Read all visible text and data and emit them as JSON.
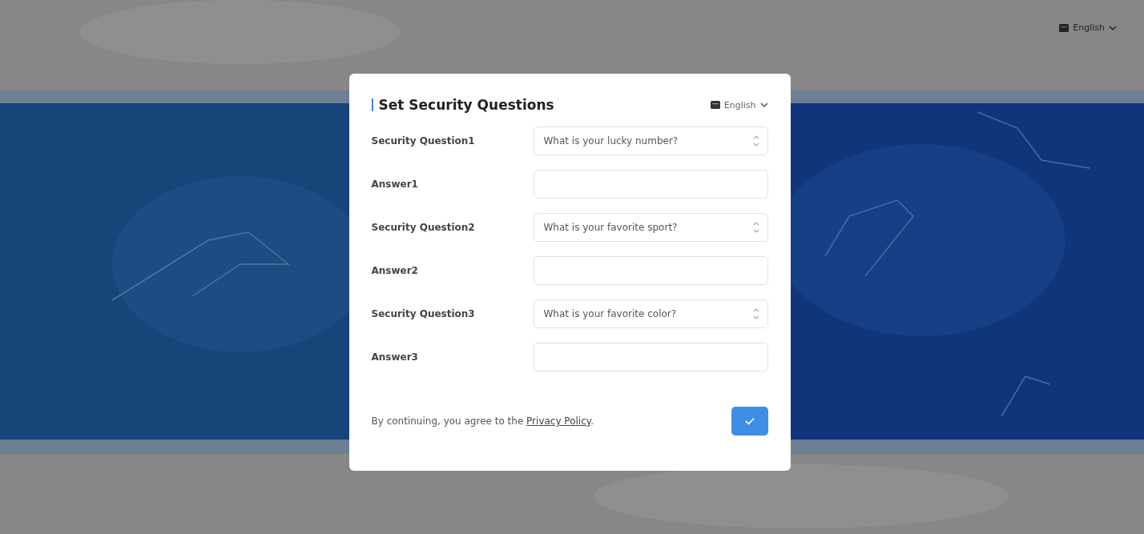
{
  "page_language": {
    "label": "English"
  },
  "dialog": {
    "title": "Set Security Questions",
    "language": {
      "label": "English"
    },
    "rows": [
      {
        "kind": "select",
        "label": "Security Question1",
        "value": "What is your lucky number?"
      },
      {
        "kind": "input",
        "label": "Answer1"
      },
      {
        "kind": "select",
        "label": "Security Question2",
        "value": "What is your favorite sport?"
      },
      {
        "kind": "input",
        "label": "Answer2"
      },
      {
        "kind": "select",
        "label": "Security Question3",
        "value": "What is your favorite color?"
      },
      {
        "kind": "input",
        "label": "Answer3"
      }
    ],
    "agreement": {
      "text": "By continuing, you agree to the ",
      "link": "Privacy Policy",
      "end": "."
    }
  }
}
